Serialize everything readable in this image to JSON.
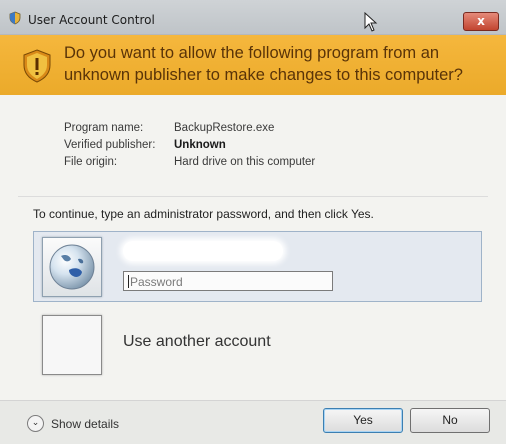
{
  "window": {
    "title": "User Account Control",
    "close_label": "x"
  },
  "banner": {
    "question": "Do you want to allow the following program from an unknown publisher to make changes to this computer?",
    "color": "#f0b032"
  },
  "details": {
    "program_name_label": "Program name:",
    "program_name": "BackupRestore.exe",
    "publisher_label": "Verified publisher:",
    "publisher": "Unknown",
    "origin_label": "File origin:",
    "origin": "Hard drive on this computer"
  },
  "credentials": {
    "instruction": "To continue, type an administrator password, and then click Yes.",
    "password_placeholder": "Password",
    "other_account_label": "Use another account"
  },
  "footer": {
    "show_details": "Show details",
    "yes": "Yes",
    "no": "No"
  },
  "icons": [
    "shield-icon",
    "globe-avatar-icon",
    "close-icon",
    "chevron-down-icon",
    "cursor-icon"
  ]
}
